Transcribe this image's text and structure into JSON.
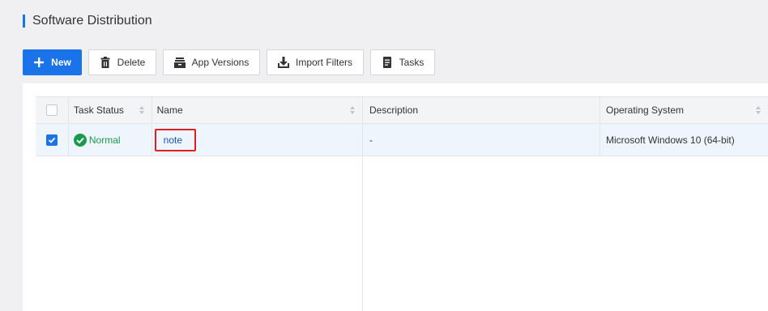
{
  "page": {
    "title": "Software Distribution"
  },
  "toolbar": {
    "new_label": "New",
    "delete_label": "Delete",
    "versions_label": "App Versions",
    "import_label": "Import Filters",
    "tasks_label": "Tasks"
  },
  "table": {
    "headers": {
      "status": "Task Status",
      "name": "Name",
      "description": "Description",
      "os": "Operating System"
    },
    "rows": [
      {
        "selected": true,
        "status": "Normal",
        "name": "note",
        "description": "-",
        "os": "Microsoft Windows 10 (64-bit)"
      }
    ]
  },
  "colors": {
    "accent": "#1a73e8",
    "success": "#1c9a4c",
    "highlight_border": "#e02020"
  }
}
